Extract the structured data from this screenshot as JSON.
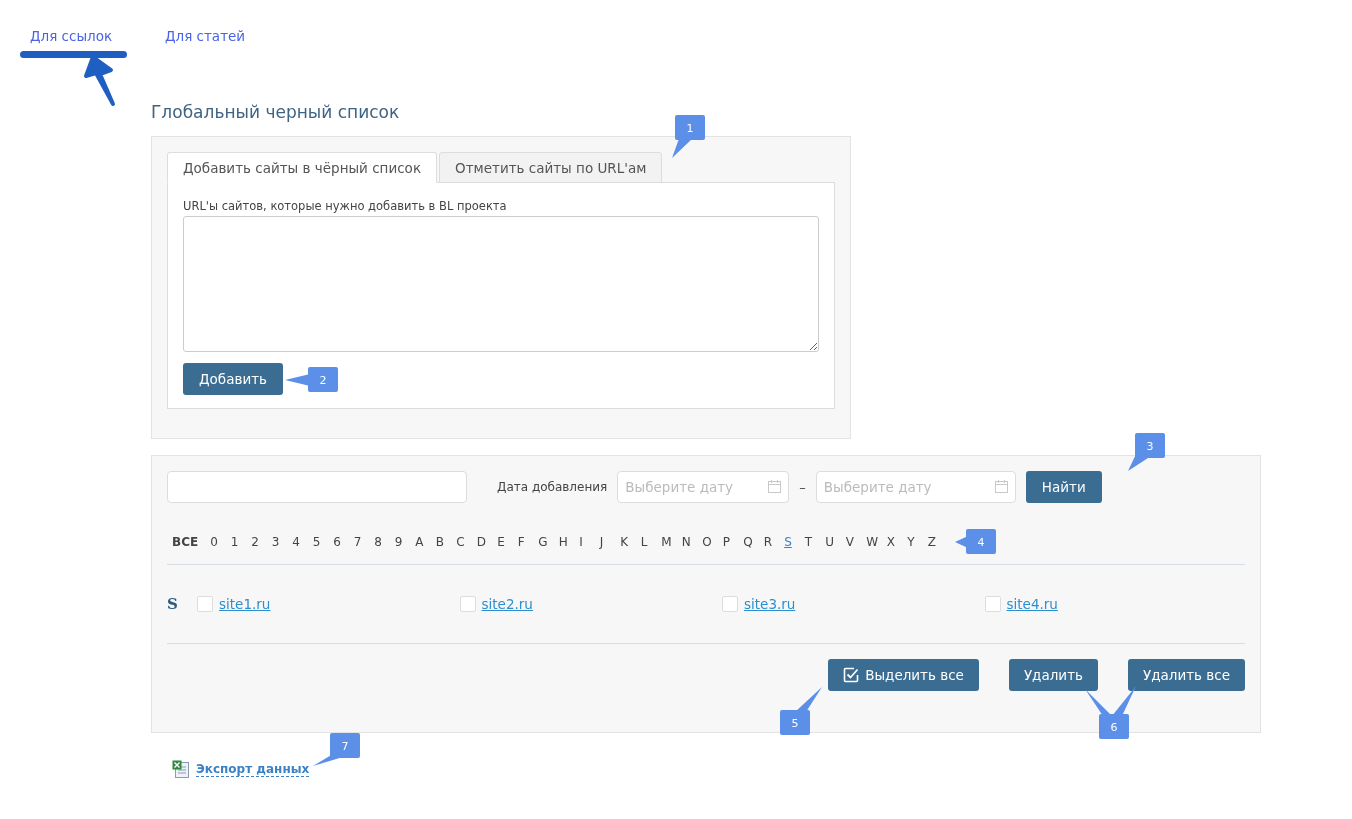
{
  "nav": [
    {
      "label": "Для ссылок",
      "selected": true
    },
    {
      "label": "Для статей",
      "selected": false
    }
  ],
  "heading": "Глобальный черный список",
  "add_panel": {
    "tabs": [
      {
        "label": "Добавить сайты в чёрный список",
        "selected": true
      },
      {
        "label": "Отметить сайты по URL'ам",
        "selected": false
      }
    ],
    "field_label": "URL'ы сайтов, которые нужно добавить в BL проекта",
    "button": "Добавить"
  },
  "filter": {
    "date_label": "Дата добавления",
    "date_from": {
      "placeholder": "Выберите дату"
    },
    "dash": "–",
    "date_to": {
      "placeholder": "Выберите дату"
    },
    "button": "Найти"
  },
  "letters": {
    "all": "ВСЕ",
    "items": [
      {
        "label": "0",
        "linked": false
      },
      {
        "label": "1",
        "linked": false
      },
      {
        "label": "2",
        "linked": false
      },
      {
        "label": "3",
        "linked": false
      },
      {
        "label": "4",
        "linked": false
      },
      {
        "label": "5",
        "linked": false
      },
      {
        "label": "6",
        "linked": false
      },
      {
        "label": "7",
        "linked": false
      },
      {
        "label": "8",
        "linked": false
      },
      {
        "label": "9",
        "linked": false
      },
      {
        "label": "A",
        "linked": false
      },
      {
        "label": "B",
        "linked": false
      },
      {
        "label": "C",
        "linked": false
      },
      {
        "label": "D",
        "linked": false
      },
      {
        "label": "E",
        "linked": false
      },
      {
        "label": "F",
        "linked": false
      },
      {
        "label": "G",
        "linked": false
      },
      {
        "label": "H",
        "linked": false
      },
      {
        "label": "I",
        "linked": false
      },
      {
        "label": "J",
        "linked": false
      },
      {
        "label": "K",
        "linked": false
      },
      {
        "label": "L",
        "linked": false
      },
      {
        "label": "M",
        "linked": false
      },
      {
        "label": "N",
        "linked": false
      },
      {
        "label": "O",
        "linked": false
      },
      {
        "label": "P",
        "linked": false
      },
      {
        "label": "Q",
        "linked": false
      },
      {
        "label": "R",
        "linked": false
      },
      {
        "label": "S",
        "linked": true
      },
      {
        "label": "T",
        "linked": false
      },
      {
        "label": "U",
        "linked": false
      },
      {
        "label": "V",
        "linked": false
      },
      {
        "label": "W",
        "linked": false
      },
      {
        "label": "X",
        "linked": false
      },
      {
        "label": "Y",
        "linked": false
      },
      {
        "label": "Z",
        "linked": false
      }
    ]
  },
  "groups": [
    {
      "letter": "S",
      "sites": [
        {
          "label": "site1.ru",
          "checked": false
        },
        {
          "label": "site2.ru",
          "checked": false
        },
        {
          "label": "site3.ru",
          "checked": false
        },
        {
          "label": "site4.ru",
          "checked": false
        }
      ]
    }
  ],
  "actions": [
    {
      "label": "Выделить все",
      "kind": "select"
    },
    {
      "label": "Удалить",
      "kind": "plain"
    },
    {
      "label": "Удалить все",
      "kind": "plain"
    }
  ],
  "export_link": "Экспорт данных",
  "callouts": [
    "1",
    "2",
    "3",
    "4",
    "5",
    "6",
    "7"
  ]
}
